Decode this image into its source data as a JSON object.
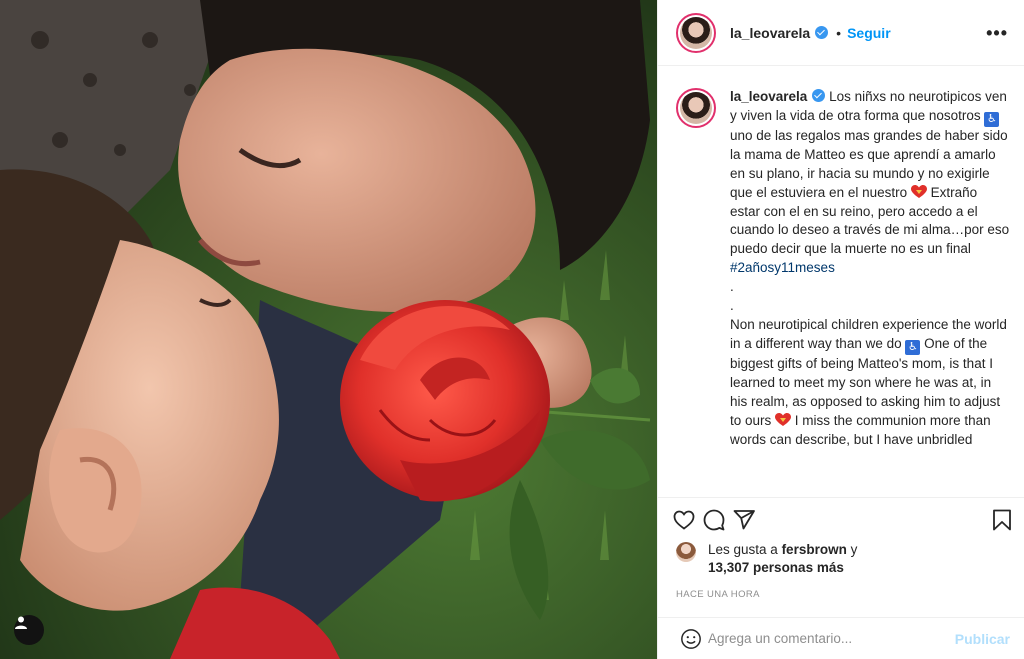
{
  "post": {
    "username": "la_leovarela",
    "follow_label": "Seguir",
    "separator": "•",
    "more_label": "•••"
  },
  "caption": {
    "username": "la_leovarela",
    "text_1": "Los niñxs no neurotipicos ven y viven la vida de otra forma que nosotros ",
    "wheel_1": "♿",
    "text_2": " uno de las regalos mas grandes de haber sido la mama de Matteo es que aprendí a amarlo en su plano, ir hacia su mundo y no exigirle que el estuviera en el nuestro ",
    "text_3": " Extraño estar con el en su reino, pero accedo a el cuando lo deseo a través de mi alma…por eso puedo decir que la muerte no es un final ",
    "hashtag": "#2añosy11meses",
    "dot_1": ".",
    "dot_2": ".",
    "text_en_1": "Non neurotipical children experience the world in a different way than we do ",
    "wheel_2": "♿",
    "text_en_2": " One of the biggest gifts of being Matteo's mom, is that I learned to meet my son where he was at, in his realm, as opposed to asking him to adjust to ours ",
    "text_en_3": " I miss the communion more than words can describe, but I have unbridled"
  },
  "likes": {
    "prefix": "Les gusta a ",
    "user": "fersbrown",
    "suffix": " y",
    "count": "13,307",
    "count_suffix": " personas más"
  },
  "timestamp": "HACE UNA HORA",
  "comment": {
    "placeholder": "Agrega un comentario...",
    "publish_label": "Publicar"
  },
  "colors": {
    "accent": "#0095f6",
    "verified": "#3897f0",
    "rose": "#e0302a",
    "hashtag": "#00376b"
  },
  "icons": [
    "user-tag-icon",
    "verified-icon",
    "more-icon",
    "heart-icon",
    "comment-icon",
    "share-icon",
    "bookmark-icon",
    "emoji-icon",
    "wheelchair-icon"
  ]
}
